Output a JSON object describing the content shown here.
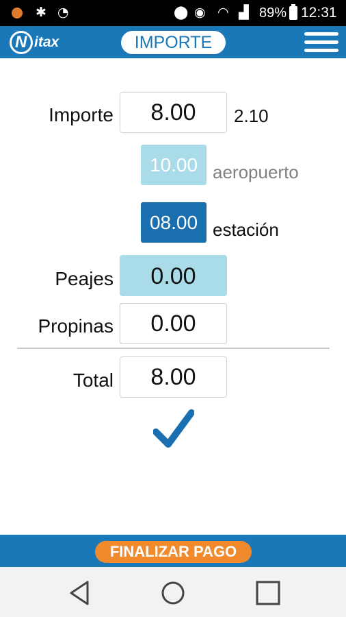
{
  "status_bar": {
    "battery": "89%",
    "time": "12:31",
    "icons": [
      "notification-dot-icon",
      "bluetooth-icon",
      "nfc-icon",
      "location-icon",
      "bluetooth-muted-icon",
      "wifi-icon",
      "signal-icon",
      "battery-icon"
    ]
  },
  "header": {
    "logo_text": "itax",
    "title": "IMPORTE",
    "menu_icon": "hamburger-menu-icon"
  },
  "form": {
    "importe": {
      "label": "Importe",
      "value": "8.00",
      "rate": "2.10"
    },
    "presets": [
      {
        "value": "10.00",
        "label": "aeropuerto"
      },
      {
        "value": "08.00",
        "label": "estación"
      }
    ],
    "peajes": {
      "label": "Peajes",
      "value": "0.00"
    },
    "propinas": {
      "label": "Propinas",
      "value": "0.00"
    },
    "total": {
      "label": "Total",
      "value": "8.00"
    },
    "confirm_icon": "checkmark-icon"
  },
  "footer": {
    "finalize_label": "FINALIZAR PAGO"
  },
  "nav": {
    "icons": [
      "back-icon",
      "home-icon",
      "recents-icon"
    ]
  },
  "colors": {
    "brand_blue": "#1a77b8",
    "accent_orange": "#f08a2c",
    "light_blue": "#a9dbe8",
    "dark_blue": "#1a6fb0"
  }
}
